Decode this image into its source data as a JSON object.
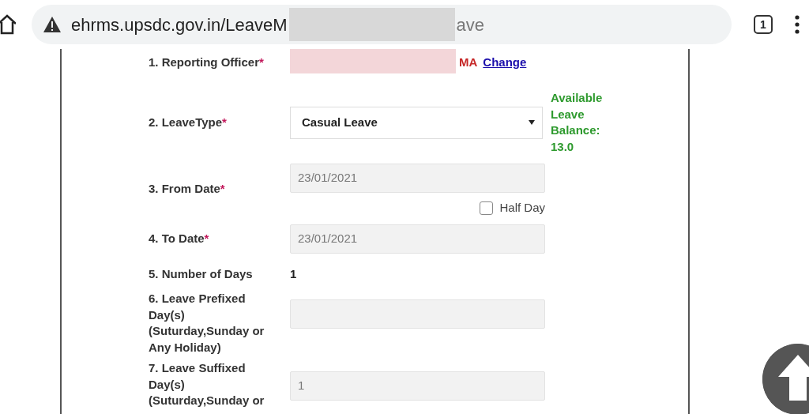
{
  "browser": {
    "url_start": "ehrms.upsdc.gov.in/LeaveM",
    "url_end": "ave",
    "tab_count": "1"
  },
  "form": {
    "rows": [
      {
        "kind": "officer",
        "label": "1. Reporting Officer",
        "mark": "*",
        "value": "MA",
        "link": "Change"
      },
      {
        "kind": "select",
        "label": "2. LeaveType",
        "mark": "*",
        "value": "Casual Leave",
        "side": "Available Leave Balance: 13.0"
      },
      {
        "kind": "date",
        "label": "3. From Date",
        "mark": "*",
        "value": "23/01/2021",
        "disabled": true,
        "checkbox": {
          "label": "Half Day",
          "checked": false
        }
      },
      {
        "kind": "date",
        "label": "4. To Date",
        "mark": "*",
        "value": "23/01/2021",
        "disabled": true
      },
      {
        "kind": "static",
        "label": "5. Number of Days",
        "value": "1"
      },
      {
        "kind": "input",
        "label": "6. Leave Prefixed Day(s) (Suturday,Sunday or Any Holiday)"
      },
      {
        "kind": "input",
        "label": "7. Leave Suffixed Day(s) (Suturday,Sunday or",
        "value": "1",
        "disabled": true
      }
    ]
  }
}
